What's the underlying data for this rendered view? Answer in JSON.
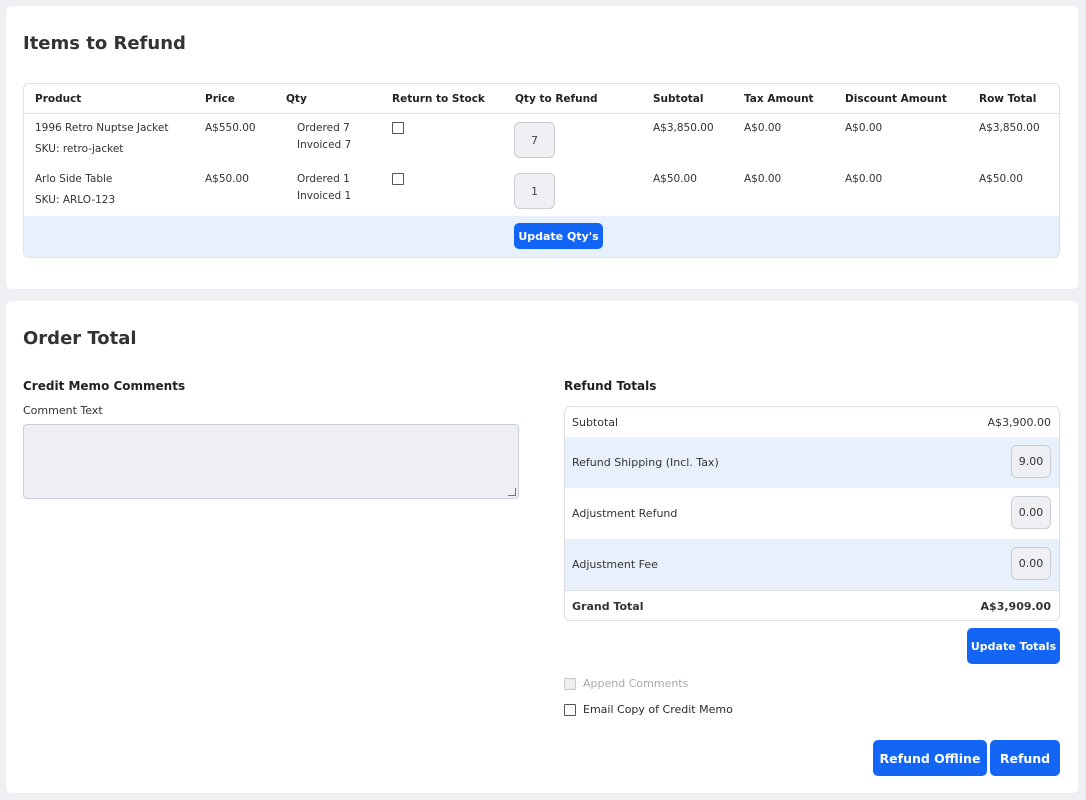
{
  "items_section": {
    "title": "Items to Refund",
    "columns": [
      "Product",
      "Price",
      "Qty",
      "Return to Stock",
      "Qty to Refund",
      "Subtotal",
      "Tax Amount",
      "Discount Amount",
      "Row Total"
    ],
    "rows": [
      {
        "product": "1996 Retro Nuptse Jacket",
        "sku": "SKU: retro-jacket",
        "price": "A$550.00",
        "ordered": "Ordered 7",
        "invoiced": "Invoiced 7",
        "return_to_stock": false,
        "qty_to_refund": "7",
        "subtotal": "A$3,850.00",
        "tax": "A$0.00",
        "discount": "A$0.00",
        "row_total": "A$3,850.00"
      },
      {
        "product": "Arlo Side Table",
        "sku": "SKU: ARLO-123",
        "price": "A$50.00",
        "ordered": "Ordered 1",
        "invoiced": "Invoiced 1",
        "return_to_stock": false,
        "qty_to_refund": "1",
        "subtotal": "A$50.00",
        "tax": "A$0.00",
        "discount": "A$0.00",
        "row_total": "A$50.00"
      }
    ],
    "update_qty_label": "Update Qty's"
  },
  "order_total": {
    "title": "Order Total",
    "comments": {
      "title": "Credit Memo Comments",
      "comment_label": "Comment Text",
      "comment_value": ""
    },
    "refund_totals": {
      "title": "Refund Totals",
      "subtotal_label": "Subtotal",
      "subtotal_value": "A$3,900.00",
      "shipping_label": "Refund Shipping (Incl. Tax)",
      "shipping_value": "9.00",
      "adjustment_refund_label": "Adjustment Refund",
      "adjustment_refund_value": "0.00",
      "adjustment_fee_label": "Adjustment Fee",
      "adjustment_fee_value": "0.00",
      "grand_total_label": "Grand Total",
      "grand_total_value": "A$3,909.00"
    },
    "update_totals_label": "Update Totals",
    "append_comments_label": "Append Comments",
    "email_copy_label": "Email Copy of Credit Memo",
    "refund_offline_label": "Refund Offline",
    "refund_label": "Refund"
  },
  "colors": {
    "accent": "#1366f5",
    "row_highlight": "#e8f0fb",
    "page_bg": "#eef0f4"
  }
}
